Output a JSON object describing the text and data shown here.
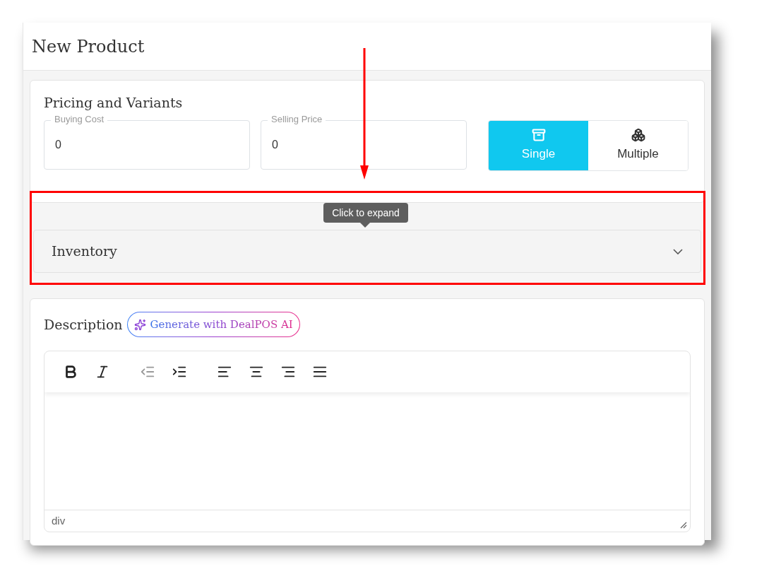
{
  "header": {
    "title": "New Product"
  },
  "pricing": {
    "title": "Pricing and Variants",
    "fields": [
      {
        "label": "Buying Cost",
        "value": "0"
      },
      {
        "label": "Selling Price",
        "value": "0"
      }
    ],
    "variant_options": [
      {
        "label": "Single",
        "kind": "single",
        "selected": true
      },
      {
        "label": "Multiple",
        "kind": "multiple",
        "selected": false
      }
    ]
  },
  "tooltip": {
    "text": "Click to expand"
  },
  "inventory": {
    "title": "Inventory",
    "expanded": false
  },
  "description": {
    "title": "Description",
    "ai_button": "Generate with DealPOS AI",
    "toolbar": [
      {
        "kind": "bold",
        "disabled": false
      },
      {
        "kind": "italic",
        "disabled": false
      },
      {
        "kind": "outdent",
        "disabled": true
      },
      {
        "kind": "indent",
        "disabled": false
      },
      {
        "kind": "align-left",
        "disabled": false
      },
      {
        "kind": "align-center",
        "disabled": false
      },
      {
        "kind": "align-right",
        "disabled": false
      },
      {
        "kind": "justify",
        "disabled": false
      }
    ],
    "status_path": "div"
  }
}
